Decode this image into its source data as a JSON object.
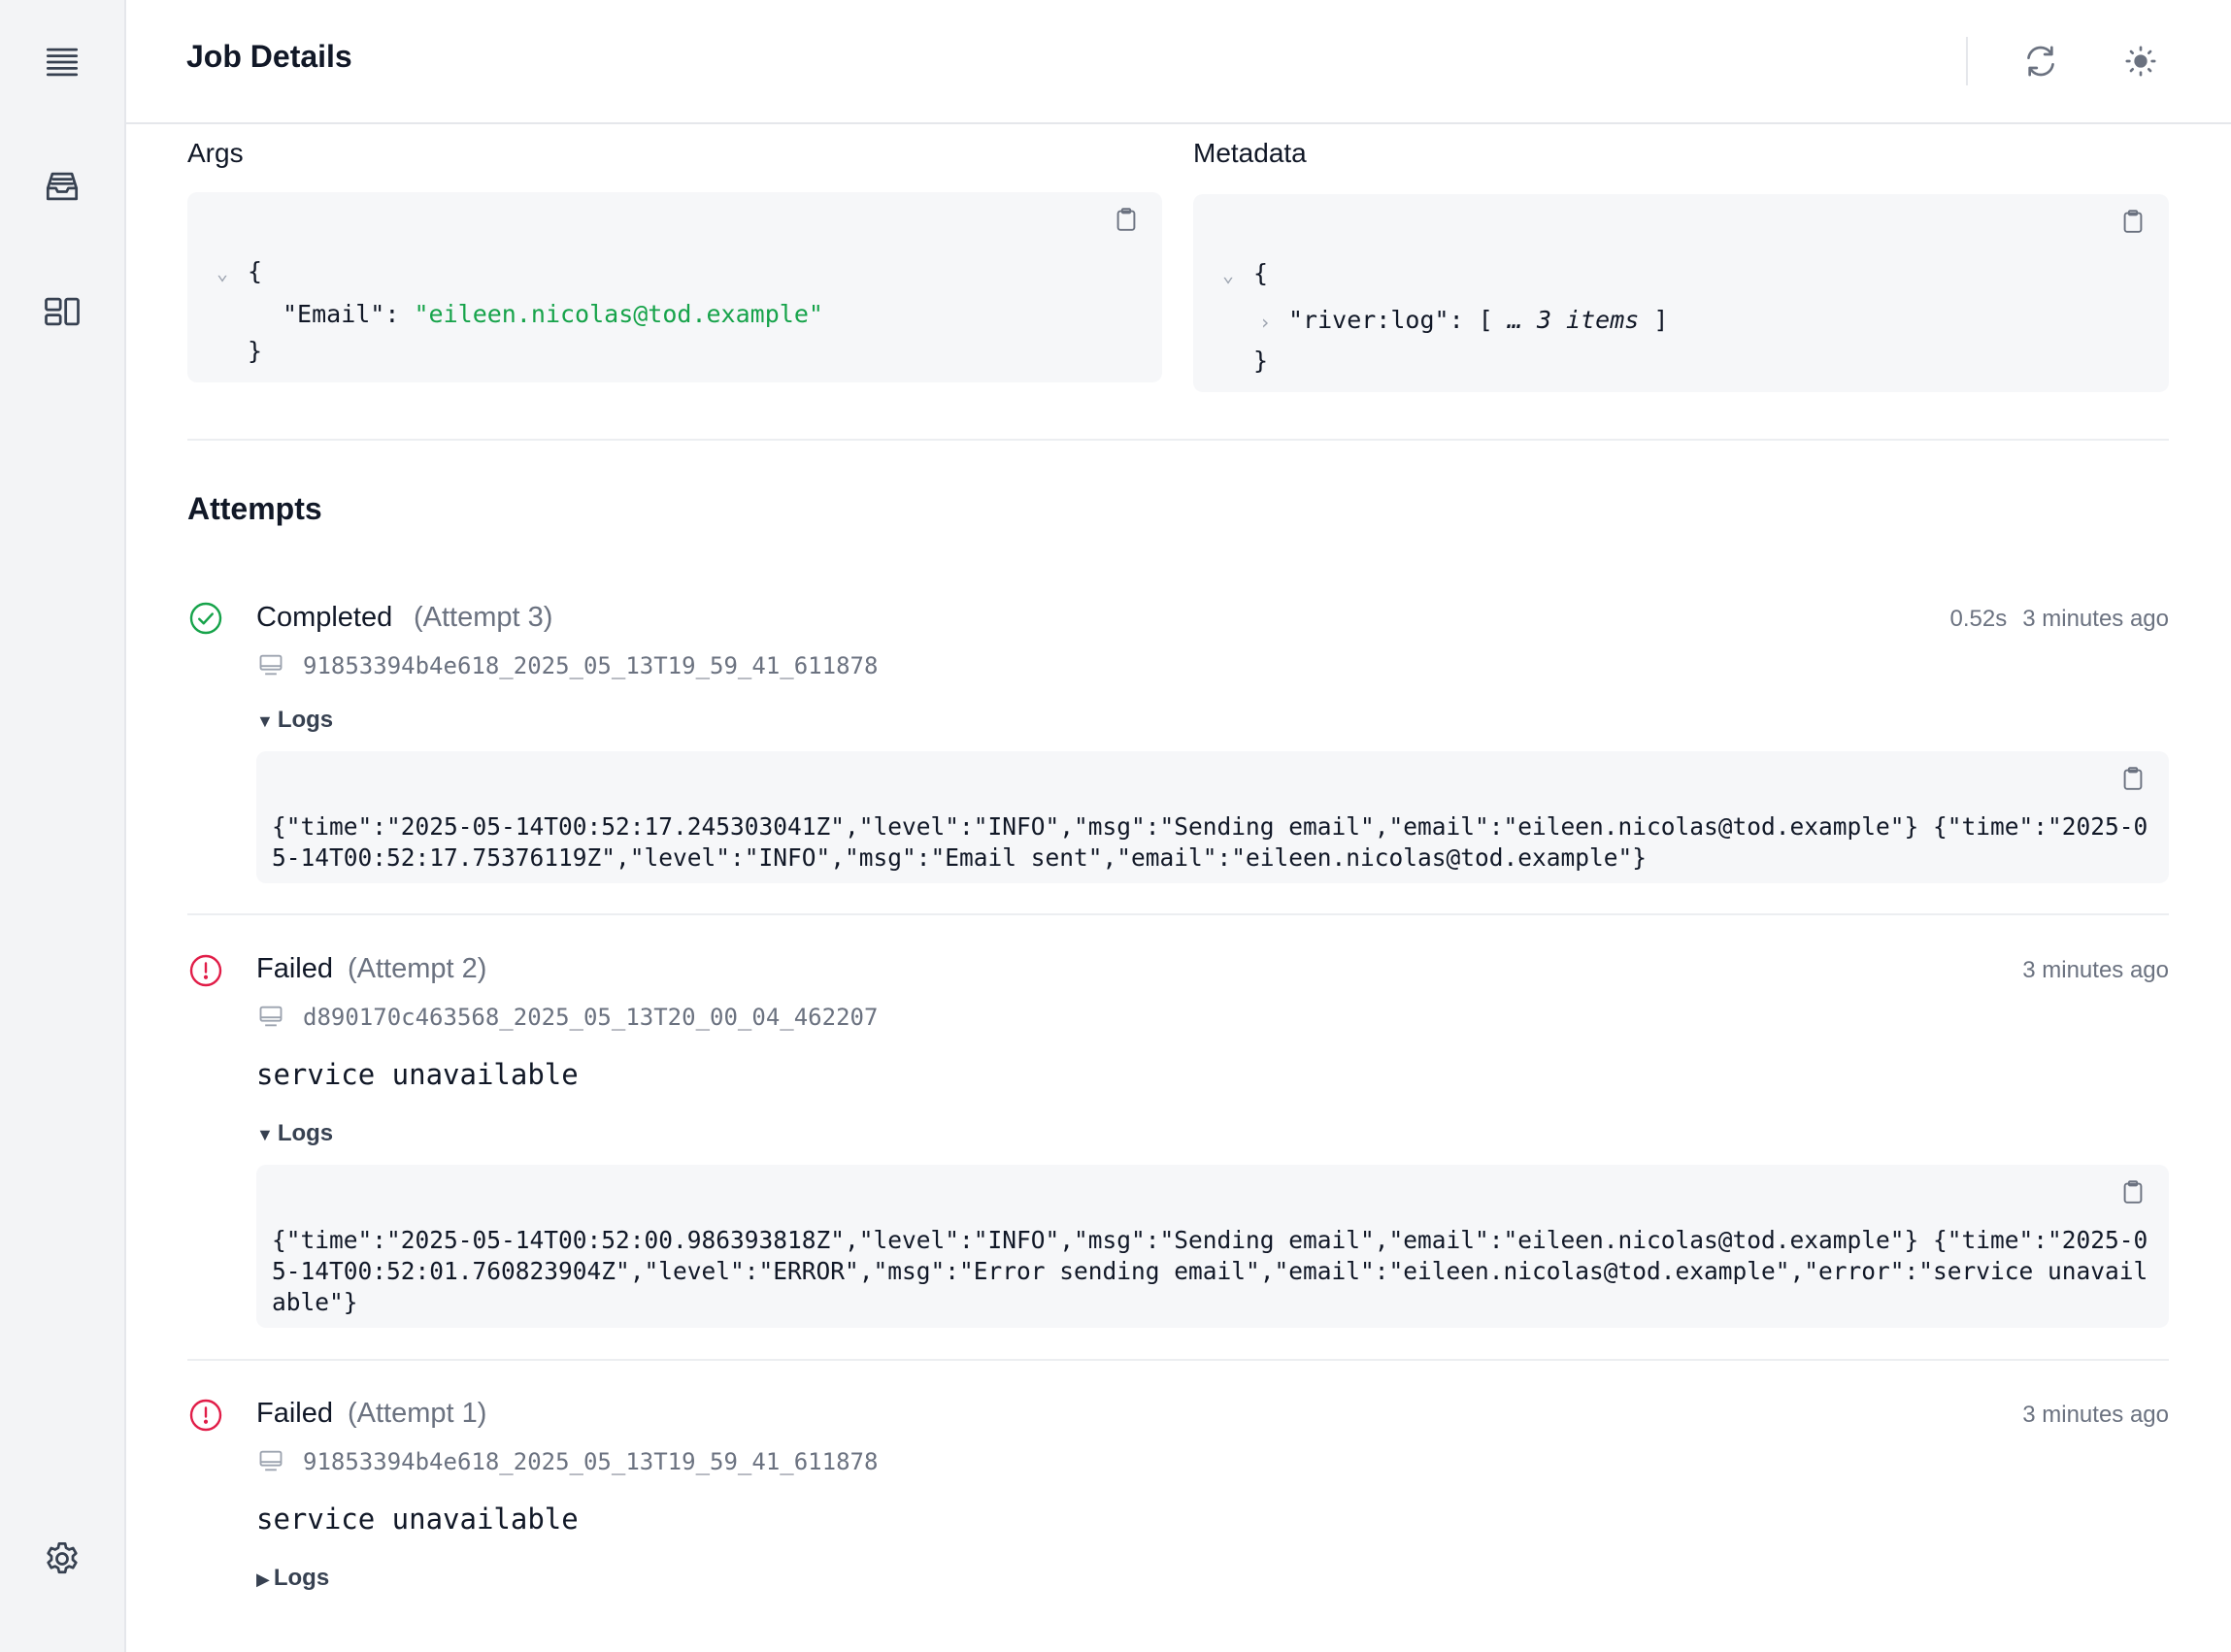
{
  "header": {
    "title": "Job Details"
  },
  "sidebar": {
    "items": [
      {
        "name": "jobs",
        "icon": "queue-list-icon"
      },
      {
        "name": "queues",
        "icon": "inbox-stack-icon"
      },
      {
        "name": "workflows",
        "icon": "squares-icon"
      },
      {
        "name": "settings",
        "icon": "gear-icon"
      }
    ]
  },
  "args": {
    "label": "Args",
    "open_brace": "{",
    "key": "\"Email\":",
    "value": "\"eileen.nicolas@tod.example\"",
    "close_brace": "}"
  },
  "metadata": {
    "label": "Metadata",
    "open_brace": "{",
    "key": "\"river:log\":",
    "array_open": "[",
    "ellipsis": "…",
    "collapsed": "3 items",
    "array_close": "]",
    "close_brace": "}"
  },
  "attempts": {
    "title": "Attempts",
    "items": [
      {
        "status": "Completed",
        "attempt": "(Attempt 3)",
        "duration": "0.52s",
        "time_ago": "3 minutes ago",
        "host": "91853394b4e618_2025_05_13T19_59_41_611878",
        "error": "",
        "logs_label": "Logs",
        "logs_open": true,
        "logs": "{\"time\":\"2025-05-14T00:52:17.245303041Z\",\"level\":\"INFO\",\"msg\":\"Sending email\",\"email\":\"eileen.nicolas@tod.example\"} {\"time\":\"2025-05-14T00:52:17.75376119Z\",\"level\":\"INFO\",\"msg\":\"Email sent\",\"email\":\"eileen.nicolas@tod.example\"}"
      },
      {
        "status": "Failed",
        "attempt": "(Attempt 2)",
        "duration": "",
        "time_ago": "3 minutes ago",
        "host": "d890170c463568_2025_05_13T20_00_04_462207",
        "error": "service unavailable",
        "logs_label": "Logs",
        "logs_open": true,
        "logs": "{\"time\":\"2025-05-14T00:52:00.986393818Z\",\"level\":\"INFO\",\"msg\":\"Sending email\",\"email\":\"eileen.nicolas@tod.example\"} {\"time\":\"2025-05-14T00:52:01.760823904Z\",\"level\":\"ERROR\",\"msg\":\"Error sending email\",\"email\":\"eileen.nicolas@tod.example\",\"error\":\"service unavailable\"}"
      },
      {
        "status": "Failed",
        "attempt": "(Attempt 1)",
        "duration": "",
        "time_ago": "3 minutes ago",
        "host": "91853394b4e618_2025_05_13T19_59_41_611878",
        "error": "service unavailable",
        "logs_label": "Logs",
        "logs_open": false,
        "logs": ""
      }
    ]
  },
  "colors": {
    "success": "#16a34a",
    "error": "#e11d48",
    "muted": "#6b7280",
    "json_string": "#16a34a"
  }
}
